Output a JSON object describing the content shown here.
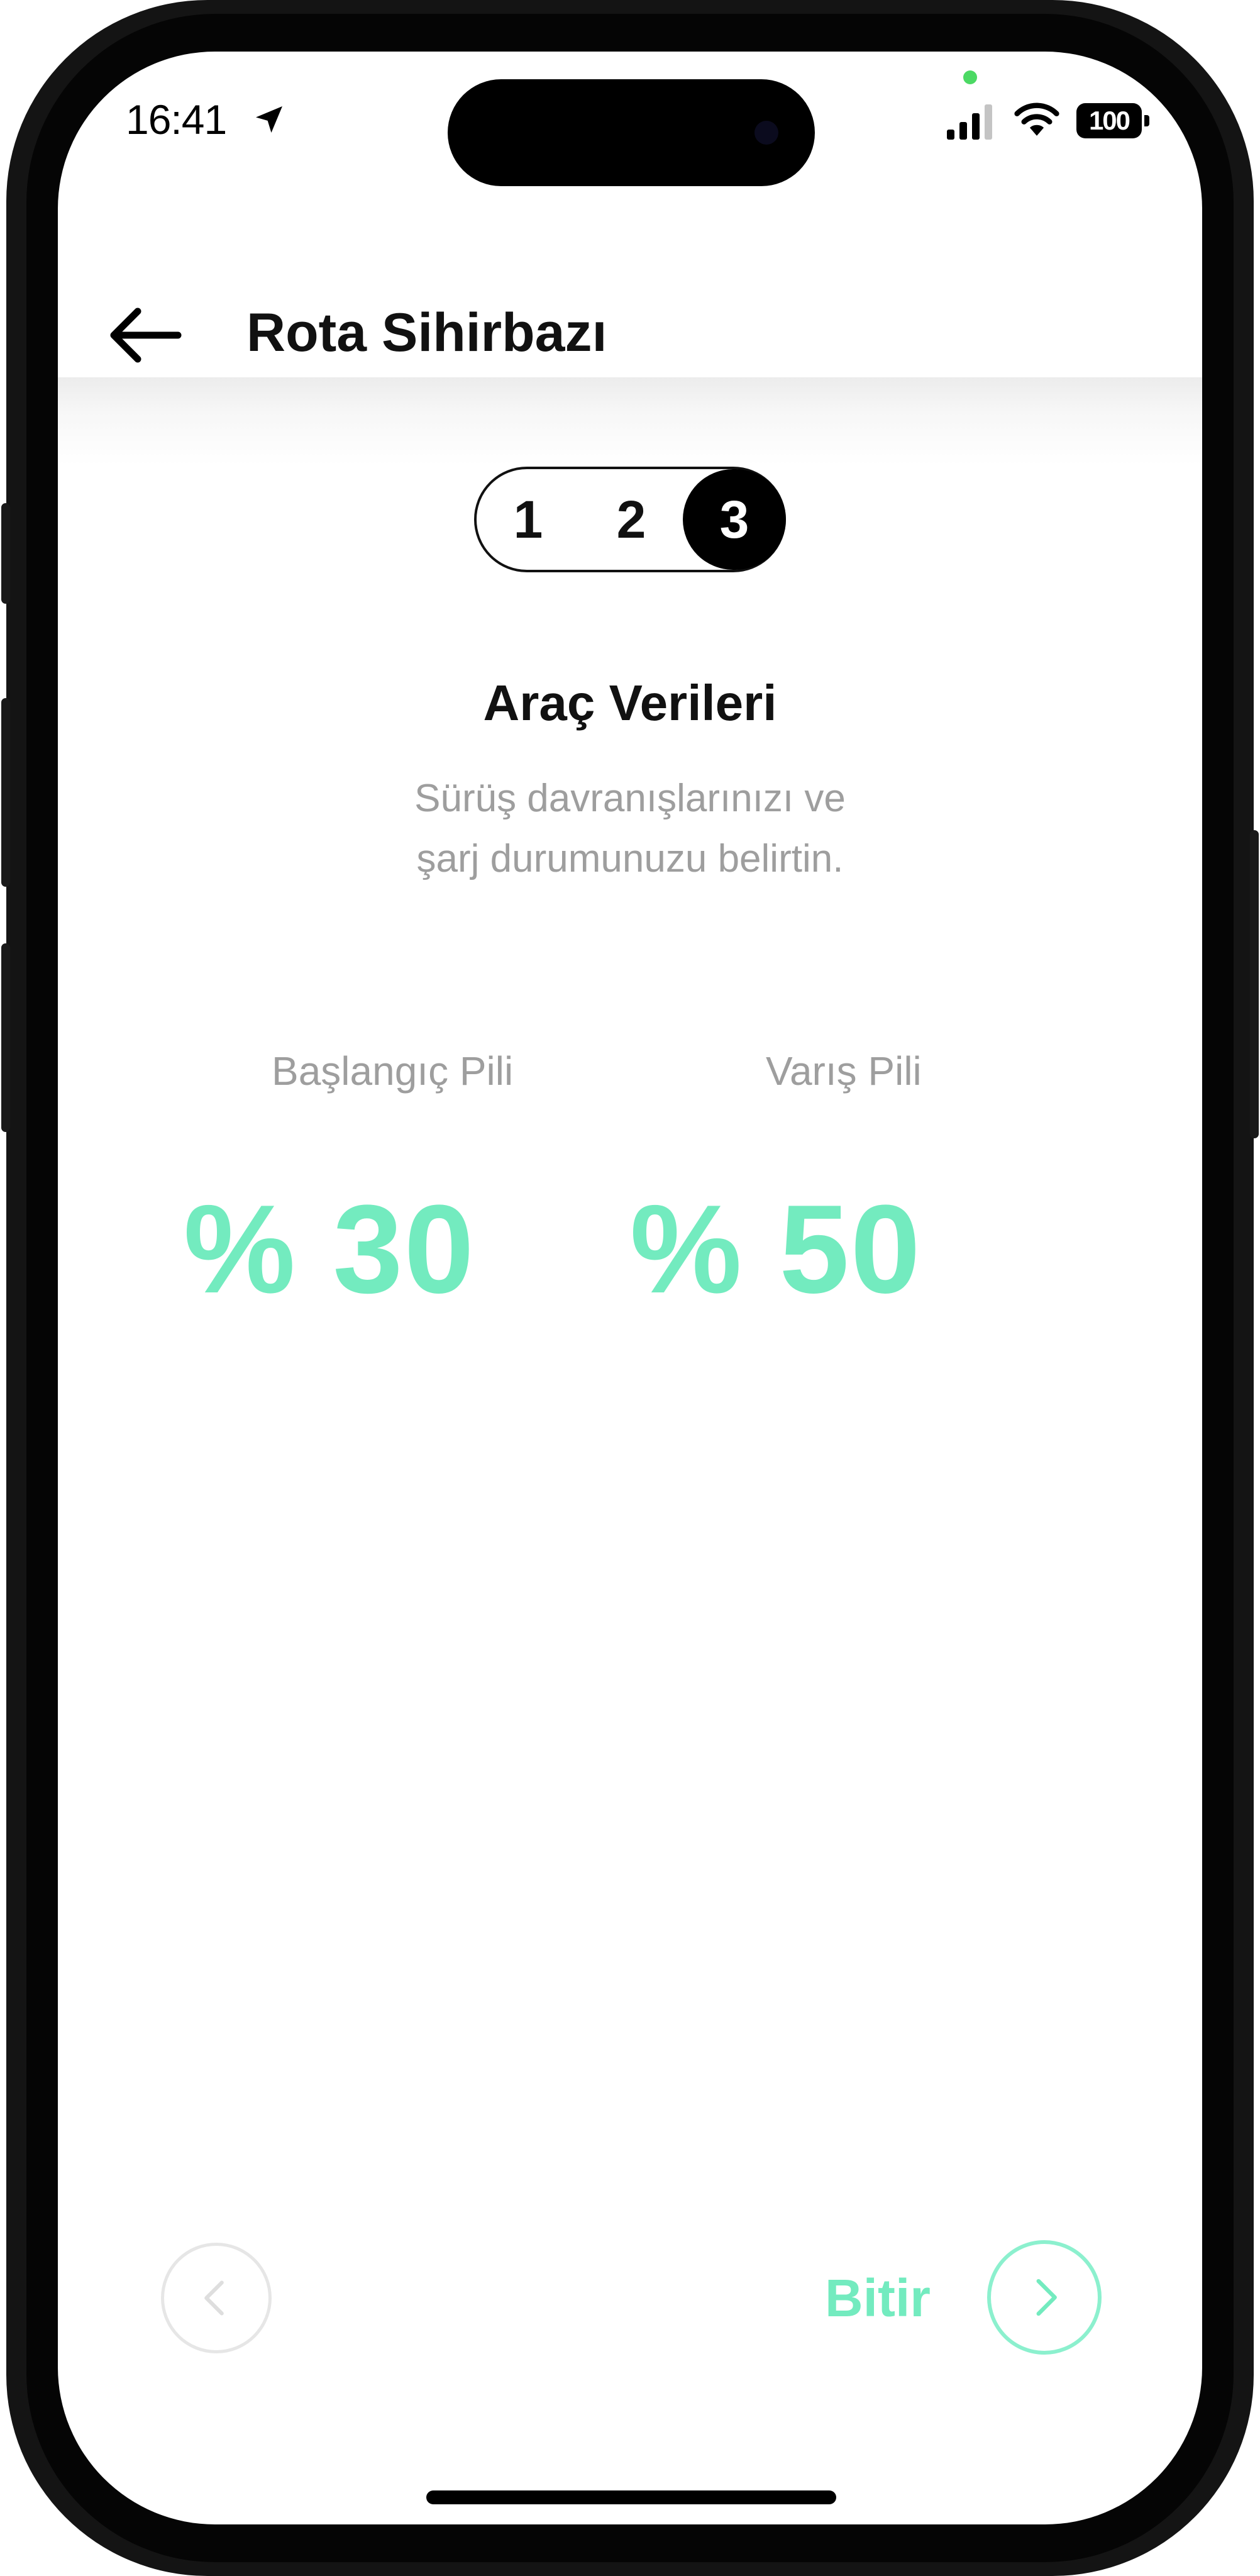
{
  "status_bar": {
    "time": "16:41",
    "battery_level": "100",
    "icons": [
      "location-arrow-icon",
      "signal-icon",
      "wifi-icon",
      "battery-icon"
    ]
  },
  "header": {
    "title": "Rota Sihirbazı",
    "back_icon": "arrow-left-icon"
  },
  "stepper": {
    "steps": [
      "1",
      "2",
      "3"
    ],
    "active_step": 3
  },
  "section": {
    "title": "Araç Verileri",
    "description_line1": "Sürüş davranışlarınızı ve",
    "description_line2": "şarj durumunuzu belirtin."
  },
  "battery": {
    "start_label": "Başlangıç Pili",
    "start_value": "% 30",
    "end_label": "Varış Pili",
    "end_value": "% 50"
  },
  "footer": {
    "prev_icon": "chevron-left-icon",
    "finish_label": "Bitir",
    "next_icon": "chevron-right-icon"
  },
  "colors": {
    "accent": "#73ebbf",
    "muted_text": "#9e9e9e",
    "text": "#111111"
  }
}
